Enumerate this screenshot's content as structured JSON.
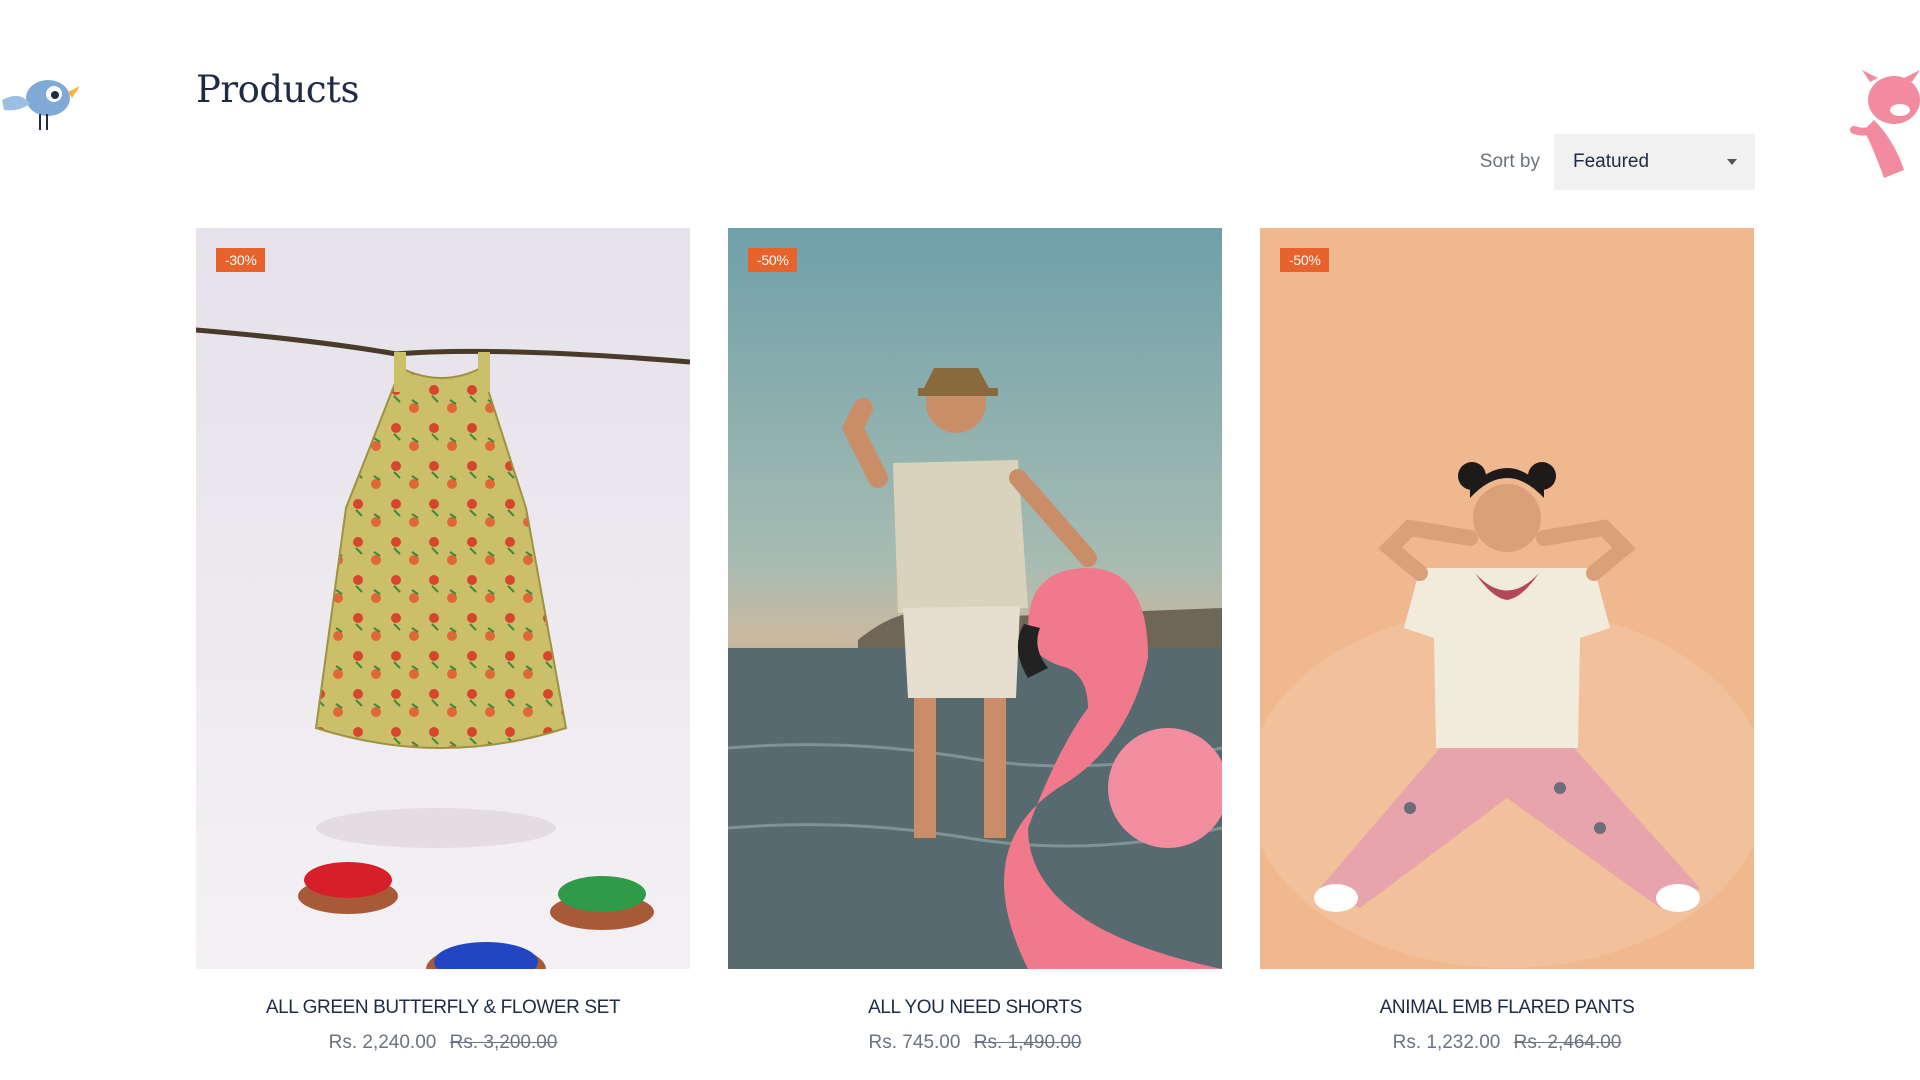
{
  "page": {
    "title": "Products"
  },
  "sort": {
    "label": "Sort by",
    "selected": "Featured"
  },
  "icons": {
    "left_mascot": "bird-mascot-icon",
    "right_mascot": "cat-mascot-icon",
    "sort_caret": "chevron-down-icon"
  },
  "colors": {
    "badge": "#e8632b",
    "title": "#1f2a44",
    "price": "#6b7280",
    "select_bg": "#f1f1f1"
  },
  "products": [
    {
      "badge": "-30%",
      "name": "ALL GREEN BUTTERFLY & FLOWER SET",
      "sale_price": "Rs. 2,240.00",
      "original_price": "Rs. 3,200.00"
    },
    {
      "badge": "-50%",
      "name": "ALL YOU NEED SHORTS",
      "sale_price": "Rs. 745.00",
      "original_price": "Rs. 1,490.00"
    },
    {
      "badge": "-50%",
      "name": "ANIMAL EMB FLARED PANTS",
      "sale_price": "Rs. 1,232.00",
      "original_price": "Rs. 2,464.00"
    }
  ]
}
